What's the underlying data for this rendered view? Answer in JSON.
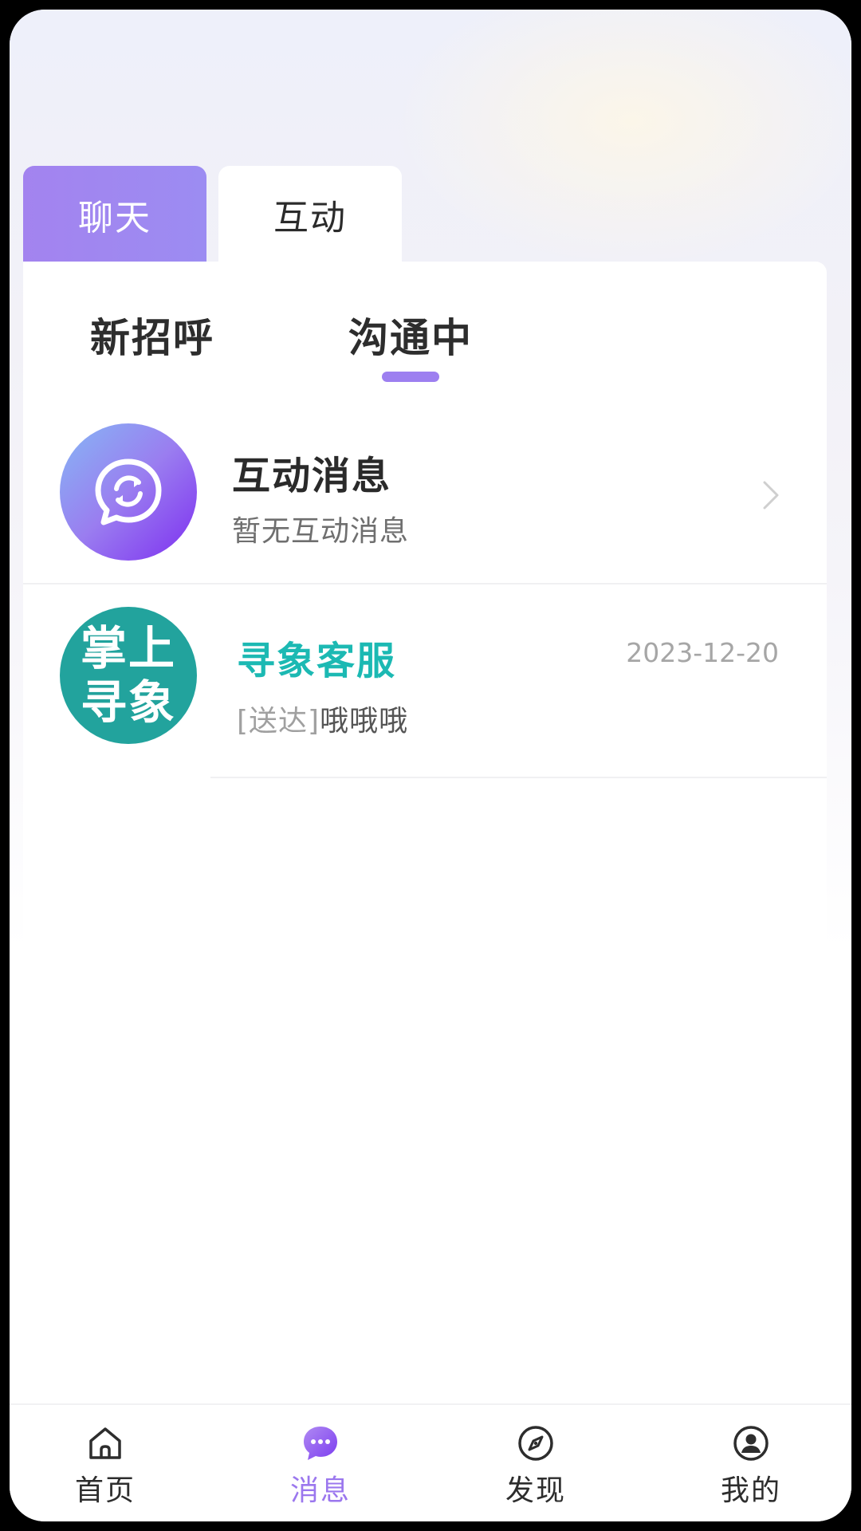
{
  "top_tabs": [
    {
      "label": "聊天",
      "active": true
    },
    {
      "label": "互动",
      "active": false
    }
  ],
  "sub_tabs": [
    {
      "label": "新招呼",
      "active": false
    },
    {
      "label": "沟通中",
      "active": true
    }
  ],
  "interaction_row": {
    "title": "互动消息",
    "subtitle": "暂无互动消息",
    "icon": "chat-sync-icon"
  },
  "chat_row": {
    "title": "寻象客服",
    "date": "2023-12-20",
    "status": "[送达]",
    "message": "哦哦哦",
    "avatar_text_line1": "掌上",
    "avatar_text_line2": "寻象"
  },
  "bottom_nav": [
    {
      "label": "首页",
      "icon": "home-icon",
      "active": false
    },
    {
      "label": "消息",
      "icon": "message-icon",
      "active": true
    },
    {
      "label": "发现",
      "icon": "compass-icon",
      "active": false
    },
    {
      "label": "我的",
      "icon": "profile-icon",
      "active": false
    }
  ],
  "colors": {
    "accent": "#9b77ee",
    "service_name": "#1cb9b3",
    "service_avatar": "#22a39d"
  }
}
